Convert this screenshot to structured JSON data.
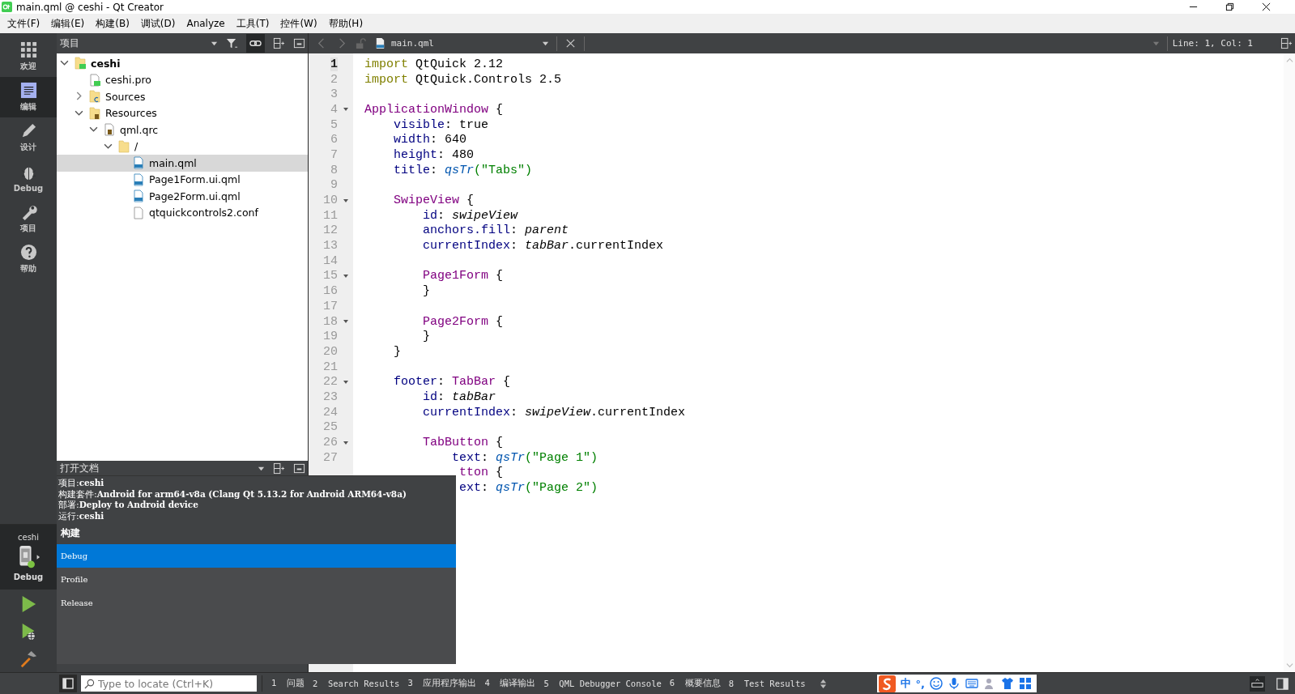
{
  "window": {
    "title": "main.qml @ ceshi - Qt Creator"
  },
  "menu_bar": [
    "文件(F)",
    "编辑(E)",
    "构建(B)",
    "调试(D)",
    "Analyze",
    "工具(T)",
    "控件(W)",
    "帮助(H)"
  ],
  "mode_bar": {
    "items": [
      {
        "label": "欢迎",
        "kind": "welcome",
        "selected": false
      },
      {
        "label": "编辑",
        "kind": "edit",
        "selected": true
      },
      {
        "label": "设计",
        "kind": "design",
        "selected": false
      },
      {
        "label": "Debug",
        "kind": "debug",
        "selected": false
      },
      {
        "label": "项目",
        "kind": "projects",
        "selected": false
      },
      {
        "label": "帮助",
        "kind": "help",
        "selected": false
      }
    ],
    "kit": {
      "project": "ceshi",
      "build": "Debug"
    }
  },
  "project_pane": {
    "title": "项目",
    "tree": [
      {
        "label": "ceshi",
        "kind": "project",
        "expanded": true,
        "selected": false,
        "children": [
          {
            "label": "ceshi.pro",
            "kind": "pro",
            "selected": false
          },
          {
            "label": "Sources",
            "kind": "sources",
            "expanded": false,
            "selected": false
          },
          {
            "label": "Resources",
            "kind": "resources",
            "expanded": true,
            "selected": false,
            "children": [
              {
                "label": "qml.qrc",
                "kind": "qrc",
                "expanded": true,
                "selected": false,
                "children": [
                  {
                    "label": "/",
                    "kind": "folder",
                    "expanded": true,
                    "selected": false,
                    "children": [
                      {
                        "label": "main.qml",
                        "kind": "qml",
                        "selected": true
                      },
                      {
                        "label": "Page1Form.ui.qml",
                        "kind": "qml",
                        "selected": false
                      },
                      {
                        "label": "Page2Form.ui.qml",
                        "kind": "qml",
                        "selected": false
                      },
                      {
                        "label": "qtquickcontrols2.conf",
                        "kind": "file",
                        "selected": false
                      }
                    ]
                  }
                ]
              }
            ]
          }
        ]
      }
    ]
  },
  "open_docs": {
    "title": "打开文档"
  },
  "editor": {
    "file": "main.qml",
    "position": "Line: 1, Col: 1",
    "lines": [
      {
        "number": "1",
        "current": true,
        "fold": false,
        "tokens": [
          {
            "t": "import",
            "kind": "kw"
          },
          {
            "t": " QtQuick 2.12",
            "kind": "plain"
          }
        ]
      },
      {
        "number": "2",
        "current": false,
        "fold": false,
        "tokens": [
          {
            "t": "import",
            "kind": "kw"
          },
          {
            "t": " QtQuick.Controls 2.5",
            "kind": "plain"
          }
        ]
      },
      {
        "number": "3",
        "current": false,
        "fold": false
      },
      {
        "number": "4",
        "current": false,
        "fold": true,
        "tokens": [
          {
            "t": "ApplicationWindow",
            "kind": "type"
          },
          {
            "t": " {",
            "kind": "plain"
          }
        ]
      },
      {
        "number": "5",
        "current": false,
        "fold": false,
        "tokens": [
          {
            "t": "    visible",
            "kind": "prop"
          },
          {
            "t": ": true",
            "kind": "plain"
          }
        ]
      },
      {
        "number": "6",
        "current": false,
        "fold": false,
        "tokens": [
          {
            "t": "    width",
            "kind": "prop"
          },
          {
            "t": ": 640",
            "kind": "plain"
          }
        ]
      },
      {
        "number": "7",
        "current": false,
        "fold": false,
        "tokens": [
          {
            "t": "    height",
            "kind": "prop"
          },
          {
            "t": ": 480",
            "kind": "plain"
          }
        ]
      },
      {
        "number": "8",
        "current": false,
        "fold": false,
        "tokens": [
          {
            "t": "    title",
            "kind": "prop"
          },
          {
            "t": ": ",
            "kind": "plain"
          },
          {
            "t": "qsTr",
            "kind": "fn"
          },
          {
            "t": "(\"Tabs\")",
            "kind": "str"
          }
        ]
      },
      {
        "number": "9",
        "current": false,
        "fold": false
      },
      {
        "number": "10",
        "current": false,
        "fold": true,
        "tokens": [
          {
            "t": "    SwipeView",
            "kind": "type"
          },
          {
            "t": " {",
            "kind": "plain"
          }
        ]
      },
      {
        "number": "11",
        "current": false,
        "fold": false,
        "tokens": [
          {
            "t": "        id",
            "kind": "prop"
          },
          {
            "t": ": ",
            "kind": "plain"
          },
          {
            "t": "swipeView",
            "kind": "ref"
          }
        ]
      },
      {
        "number": "12",
        "current": false,
        "fold": false,
        "tokens": [
          {
            "t": "        anchors.fill",
            "kind": "prop"
          },
          {
            "t": ": ",
            "kind": "plain"
          },
          {
            "t": "parent",
            "kind": "ref"
          }
        ]
      },
      {
        "number": "13",
        "current": false,
        "fold": false,
        "tokens": [
          {
            "t": "        currentIndex",
            "kind": "prop"
          },
          {
            "t": ": ",
            "kind": "plain"
          },
          {
            "t": "tabBar",
            "kind": "ref"
          },
          {
            "t": ".currentIndex",
            "kind": "plain"
          }
        ]
      },
      {
        "number": "14",
        "current": false,
        "fold": false
      },
      {
        "number": "15",
        "current": false,
        "fold": true,
        "tokens": [
          {
            "t": "        Page1Form",
            "kind": "type"
          },
          {
            "t": " {",
            "kind": "plain"
          }
        ]
      },
      {
        "number": "16",
        "current": false,
        "fold": false,
        "tokens": [
          {
            "t": "        }",
            "kind": "plain"
          }
        ]
      },
      {
        "number": "17",
        "current": false,
        "fold": false
      },
      {
        "number": "18",
        "current": false,
        "fold": true,
        "tokens": [
          {
            "t": "        Page2Form",
            "kind": "type"
          },
          {
            "t": " {",
            "kind": "plain"
          }
        ]
      },
      {
        "number": "19",
        "current": false,
        "fold": false,
        "tokens": [
          {
            "t": "        }",
            "kind": "plain"
          }
        ]
      },
      {
        "number": "20",
        "current": false,
        "fold": false,
        "tokens": [
          {
            "t": "    }",
            "kind": "plain"
          }
        ]
      },
      {
        "number": "21",
        "current": false,
        "fold": false
      },
      {
        "number": "22",
        "current": false,
        "fold": true,
        "tokens": [
          {
            "t": "    footer",
            "kind": "prop"
          },
          {
            "t": ": ",
            "kind": "plain"
          },
          {
            "t": "TabBar",
            "kind": "type"
          },
          {
            "t": " {",
            "kind": "plain"
          }
        ]
      },
      {
        "number": "23",
        "current": false,
        "fold": false,
        "tokens": [
          {
            "t": "        id",
            "kind": "prop"
          },
          {
            "t": ": ",
            "kind": "plain"
          },
          {
            "t": "tabBar",
            "kind": "ref"
          }
        ]
      },
      {
        "number": "24",
        "current": false,
        "fold": false,
        "tokens": [
          {
            "t": "        currentIndex",
            "kind": "prop"
          },
          {
            "t": ": ",
            "kind": "plain"
          },
          {
            "t": "swipeView",
            "kind": "ref"
          },
          {
            "t": ".currentIndex",
            "kind": "plain"
          }
        ]
      },
      {
        "number": "25",
        "current": false,
        "fold": false
      },
      {
        "number": "26",
        "current": false,
        "fold": true,
        "tokens": [
          {
            "t": "        TabButton",
            "kind": "type"
          },
          {
            "t": " {",
            "kind": "plain"
          }
        ]
      },
      {
        "number": "27",
        "current": false,
        "fold": false,
        "tokens": [
          {
            "t": "            text",
            "kind": "prop"
          },
          {
            "t": ": ",
            "kind": "plain"
          },
          {
            "t": "qsTr",
            "kind": "fn"
          },
          {
            "t": "(\"Page 1\")",
            "kind": "str"
          }
        ]
      },
      {
        "tokens": [
          {
            "t": "             tton",
            "kind": "type"
          },
          {
            "t": " {",
            "kind": "plain"
          }
        ]
      },
      {
        "tokens": [
          {
            "t": "             ext",
            "kind": "prop"
          },
          {
            "t": ": ",
            "kind": "plain"
          },
          {
            "t": "qsTr",
            "kind": "fn"
          },
          {
            "t": "(\"Page 2\")",
            "kind": "str"
          }
        ]
      }
    ]
  },
  "kit_popup": {
    "info": [
      {
        "label": "项目:",
        "value": "ceshi"
      },
      {
        "label": "构建套件:",
        "value": "Android for arm64-v8a (Clang Qt 5.13.2 for Android ARM64-v8a)"
      },
      {
        "label": "部署:",
        "value": "Deploy to Android device"
      },
      {
        "label": "运行:",
        "value": "ceshi"
      }
    ],
    "section": "构建",
    "options": [
      {
        "label": "Debug",
        "selected": true
      },
      {
        "label": "Profile",
        "selected": false
      },
      {
        "label": "Release",
        "selected": false
      }
    ]
  },
  "status_bar": {
    "search": {
      "placeholder": "Type to locate (Ctrl+K)"
    },
    "tabs": [
      {
        "number": "1",
        "label": "问题"
      },
      {
        "number": "2",
        "label": "Search Results"
      },
      {
        "number": "3",
        "label": "应用程序输出"
      },
      {
        "number": "4",
        "label": "编译输出"
      },
      {
        "number": "5",
        "label": "QML Debugger Console"
      },
      {
        "number": "6",
        "label": "概要信息"
      },
      {
        "number": "8",
        "label": "Test Results"
      }
    ],
    "ime": {
      "mode": "中",
      "punct": "°,"
    }
  }
}
